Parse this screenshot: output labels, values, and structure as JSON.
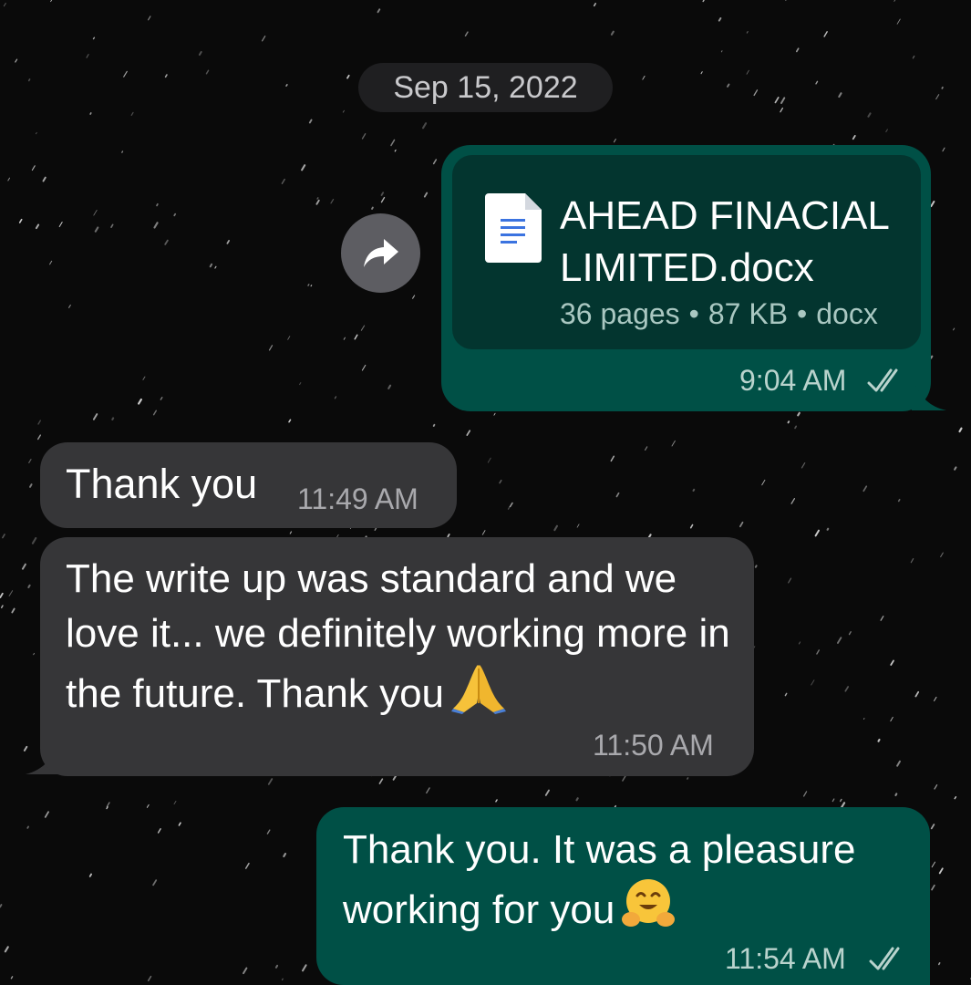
{
  "chat": {
    "date_separator": "Sep 15, 2022"
  },
  "messages": [
    {
      "direction": "outgoing",
      "type": "document",
      "file_name": "AHEAD FINACIAL LIMITED.docx",
      "file_pages": "36 pages",
      "file_size": "87 KB",
      "file_ext": "docx",
      "meta_separator": "•",
      "time": "9:04 AM",
      "status_icon": "double-check-icon",
      "forward_icon": "forward-arrow-icon"
    },
    {
      "direction": "incoming",
      "type": "text",
      "text": "Thank you",
      "time": "11:49 AM"
    },
    {
      "direction": "incoming",
      "type": "text",
      "text": "The write up was standard and we love it... we definitely working more in the future. Thank you",
      "emoji": "folded-hands-emoji",
      "time": "11:50 AM"
    },
    {
      "direction": "outgoing",
      "type": "text",
      "text": "Thank you. It was a pleasure working for you",
      "emoji": "hugging-face-emoji",
      "time": "11:54 AM",
      "status_icon": "double-check-icon"
    }
  ],
  "colors": {
    "background": "#0a0a0a",
    "outgoing_bubble": "#005046",
    "incoming_bubble": "#363638",
    "document_card": "#03352f",
    "date_chip": "#1f1f21"
  }
}
